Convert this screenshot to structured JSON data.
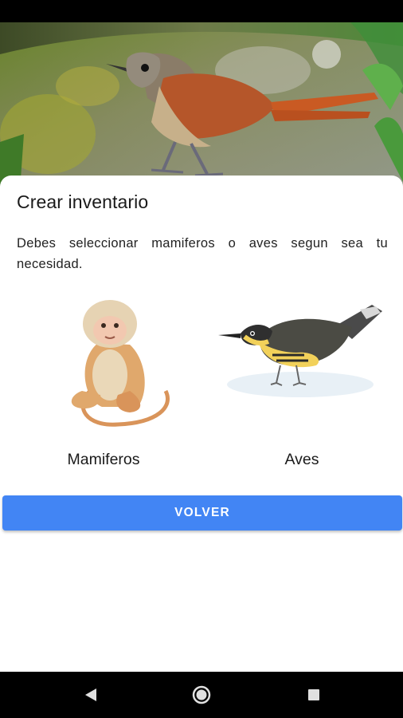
{
  "dialog": {
    "title": "Crear inventario",
    "description": "Debes seleccionar mamiferos o aves segun sea tu necesidad."
  },
  "options": [
    {
      "label": "Mamiferos",
      "icon": "monkey-illustration"
    },
    {
      "label": "Aves",
      "icon": "bird-illustration"
    }
  ],
  "actions": {
    "back_label": "VOLVER"
  },
  "navigation": {
    "back_icon": "triangle-back-icon",
    "home_icon": "circle-home-icon",
    "recent_icon": "square-recents-icon"
  },
  "colors": {
    "primary_button": "#4285f4",
    "sheet_background": "#ffffff",
    "system_bars": "#000000"
  }
}
